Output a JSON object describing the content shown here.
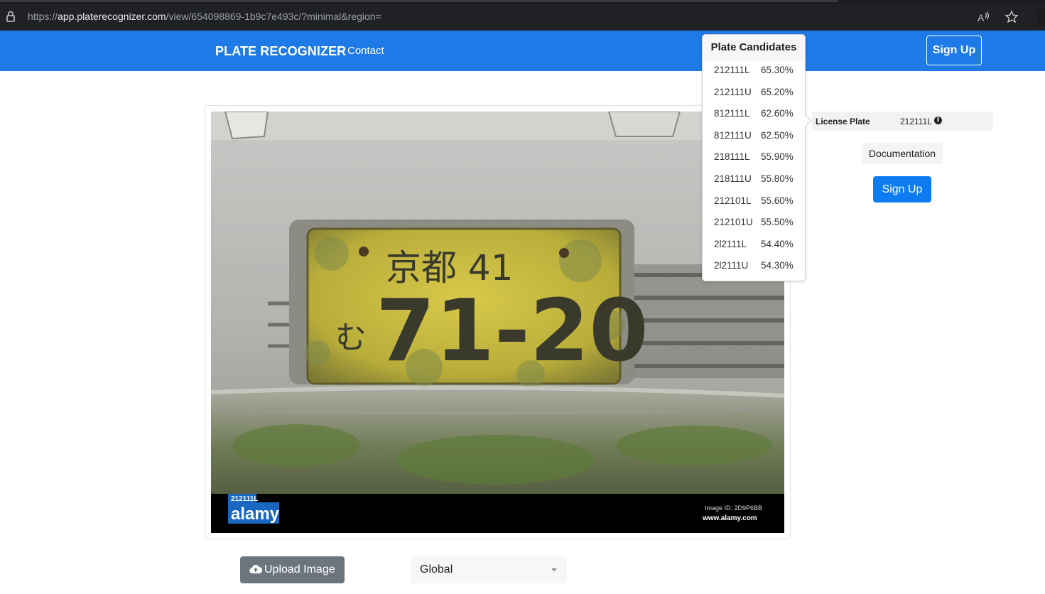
{
  "browser": {
    "url_prefix": "https://",
    "url_host": "app.platerecognizer.com",
    "url_path": "/view/654098869-1b9c7e493c/?minimal&region="
  },
  "navbar": {
    "brand": "PLATE RECOGNIZER",
    "contact": "Contact",
    "signup": "Sign Up"
  },
  "photo": {
    "plate_text_top": "京都 41",
    "plate_text_main": "71-20",
    "plate_prefix": "む",
    "badge_label": "212111L",
    "watermark_brand": "alamy",
    "image_id": "Image ID: 2D9P6BB",
    "site": "www.alamy.com"
  },
  "candidates": {
    "title": "Plate Candidates",
    "items": [
      {
        "plate": "212111L",
        "score": "65.30%"
      },
      {
        "plate": "212111U",
        "score": "65.20%"
      },
      {
        "plate": "812111L",
        "score": "62.60%"
      },
      {
        "plate": "812111U",
        "score": "62.50%"
      },
      {
        "plate": "218111L",
        "score": "55.90%"
      },
      {
        "plate": "218111U",
        "score": "55.80%"
      },
      {
        "plate": "212101L",
        "score": "55.60%"
      },
      {
        "plate": "212101U",
        "score": "55.50%"
      },
      {
        "plate": "2l2111L",
        "score": "54.40%"
      },
      {
        "plate": "2l2111U",
        "score": "54.30%"
      }
    ]
  },
  "result": {
    "label": "License Plate",
    "value": "212111L",
    "info_icon": "i"
  },
  "sidebar": {
    "documentation": "Documentation",
    "signup": "Sign Up"
  },
  "controls": {
    "upload": "Upload Image",
    "region": "Global"
  }
}
